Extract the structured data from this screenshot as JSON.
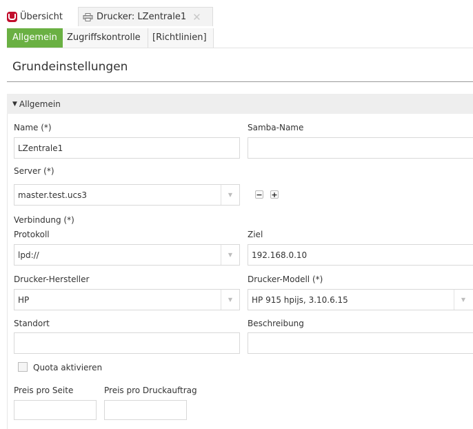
{
  "tabs": {
    "overview_label": "Übersicht",
    "printer_label": "Drucker: LZentrale1",
    "close_glyph": "✕"
  },
  "subtabs": [
    "Allgemein",
    "Zugriffskontrolle",
    "[Richtlinien]"
  ],
  "page_title": "Grundeinstellungen",
  "section": {
    "title": "Allgemein",
    "caret": "▼"
  },
  "fields": {
    "name": {
      "label": "Name (*)",
      "value": "LZentrale1"
    },
    "samba_name": {
      "label": "Samba-Name",
      "value": ""
    },
    "server": {
      "label": "Server (*)",
      "value": "master.test.ucs3"
    },
    "verbindung_label": "Verbindung (*)",
    "protokoll": {
      "label": "Protokoll",
      "value": "lpd://"
    },
    "ziel": {
      "label": "Ziel",
      "value": "192.168.0.10"
    },
    "hersteller": {
      "label": "Drucker-Hersteller",
      "value": "HP"
    },
    "modell": {
      "label": "Drucker-Modell (*)",
      "value": "HP 915 hpijs, 3.10.6.15"
    },
    "standort": {
      "label": "Standort",
      "value": ""
    },
    "beschreibung": {
      "label": "Beschreibung",
      "value": ""
    },
    "quota": {
      "label": "Quota aktivieren",
      "checked": false
    },
    "preis_seite": {
      "label": "Preis pro Seite",
      "value": ""
    },
    "preis_auftrag": {
      "label": "Preis pro Druckauftrag",
      "value": ""
    }
  },
  "buttons": {
    "remove_glyph": "−",
    "add_glyph": "+"
  },
  "icons": {
    "logo": "univention-logo-icon",
    "printer": "printer-icon",
    "select_arrow": "▼"
  },
  "colors": {
    "accent": "#6ab043",
    "logo": "#c20e2d",
    "section_bg": "#eeeeee"
  }
}
